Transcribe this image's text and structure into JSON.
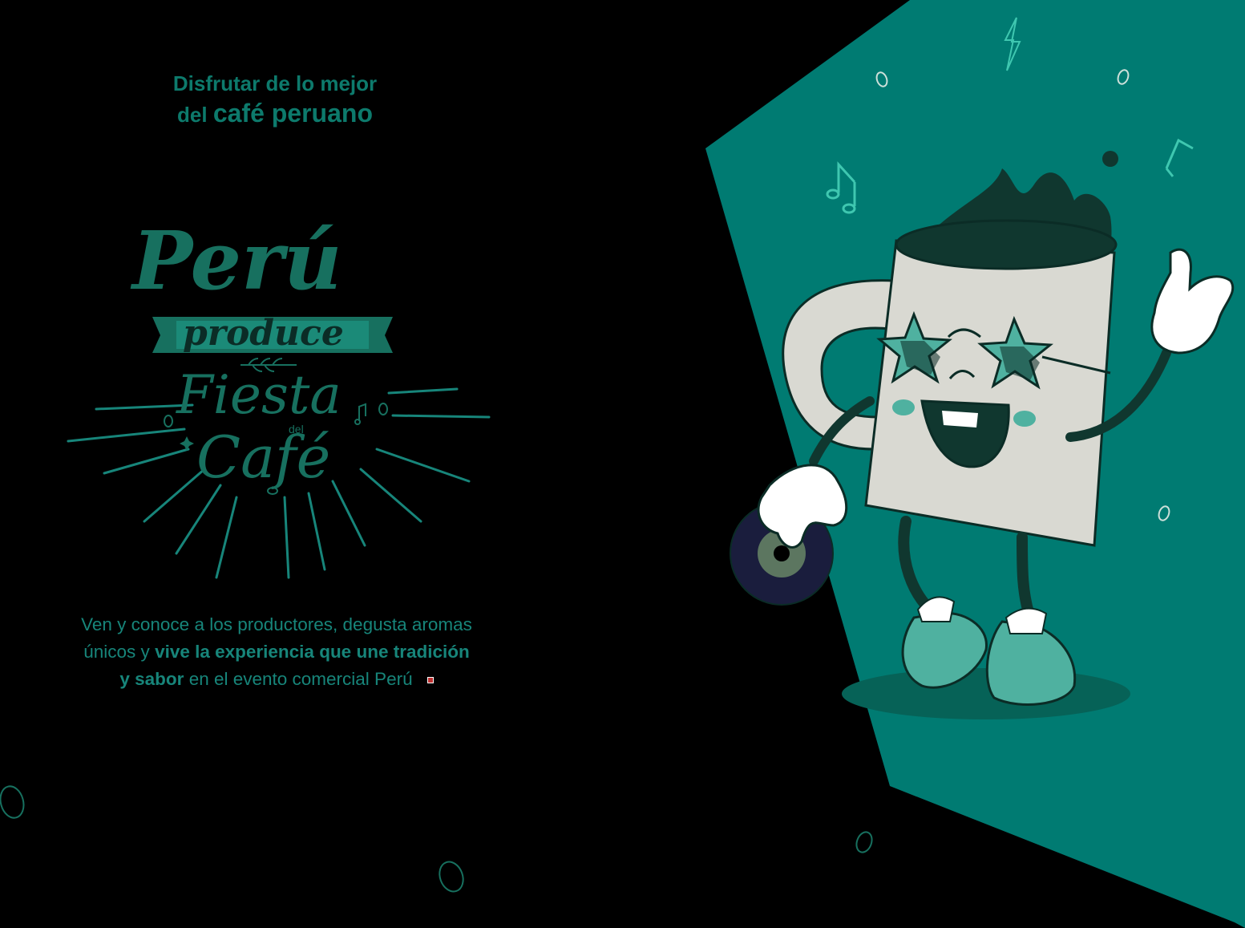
{
  "tagline": {
    "line1": "Disfrutar de lo mejor",
    "line2_prefix": "del ",
    "line2_bold": "café peruano"
  },
  "logo": {
    "peru": "Perú",
    "produce": "produce",
    "fiesta": "Fiesta",
    "del": "del",
    "cafe": "Café"
  },
  "description": {
    "part1": "Ven y conoce a los productores, degusta aromas únicos y ",
    "bold": "vive la experiencia que une tradición y sabor",
    "part2": " en el evento comercial Perú"
  },
  "colors": {
    "background": "#000000",
    "brand_green": "#0d7a6c",
    "panel_teal": "#007b72",
    "accent_mint": "#4fb1a0"
  }
}
